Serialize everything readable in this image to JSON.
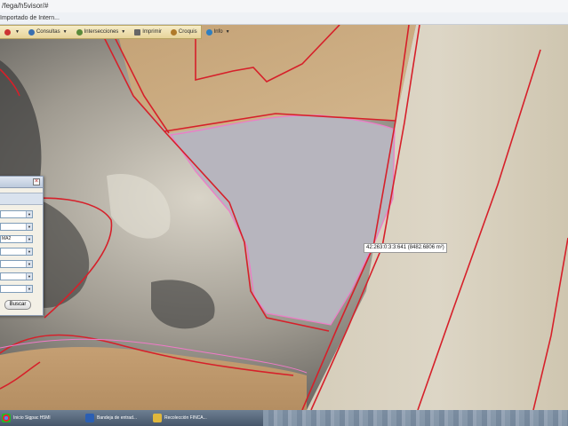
{
  "browser": {
    "url": "/fega/h5visor/#",
    "favorites_label": "Importado de Intern..."
  },
  "toolbar": {
    "items": [
      {
        "label": "",
        "icon": "arrow-icon",
        "dropdown": true
      },
      {
        "label": "Consultas",
        "icon": "query-icon",
        "dropdown": true
      },
      {
        "label": "Intersecciones",
        "icon": "intersect-icon",
        "dropdown": true
      },
      {
        "label": "Imprimir",
        "icon": "print-icon",
        "dropdown": false
      },
      {
        "label": "Croquis",
        "icon": "sketch-icon",
        "dropdown": false
      },
      {
        "label": "Info",
        "icon": "info-icon",
        "dropdown": true
      }
    ]
  },
  "search_panel": {
    "close_label": "×",
    "fields": [
      {
        "value": ""
      },
      {
        "value": ""
      },
      {
        "value": "MA2"
      },
      {
        "value": ""
      },
      {
        "value": ""
      },
      {
        "value": ""
      },
      {
        "value": ""
      }
    ],
    "search_button": "Buscar"
  },
  "map": {
    "selected_parcel_tooltip": "42:263:0:3:3:641 (8482.6806 m²)",
    "colors": {
      "parcel_border": "#d6202a",
      "selection_border": "#f07ac8",
      "field_tan": "#c9a87c",
      "field_light": "#d8d0bd",
      "selected_fill": "#b9b7bf",
      "scrub": "#a8a49a"
    }
  },
  "taskbar": {
    "items": [
      {
        "label": "Inicio Sigpac H5MI",
        "icon": "chrome-icon"
      },
      {
        "label": "Bandeja de entrad...",
        "icon": "mail-icon"
      },
      {
        "label": "Recolección FINCA...",
        "icon": "folder-icon"
      }
    ]
  }
}
